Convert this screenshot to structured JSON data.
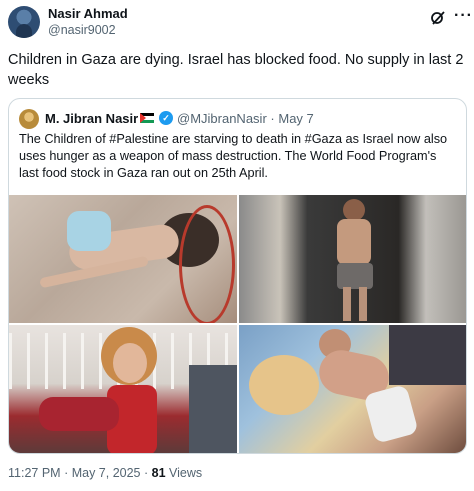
{
  "post": {
    "author_name": "Nasir Ahmad",
    "author_handle": "@nasir9002",
    "text": "Children in Gaza are dying. Israel has blocked food. No supply in last 2 weeks",
    "time": "11:27 PM",
    "separator": "·",
    "date": "May 7, 2025",
    "views_count": "81",
    "views_label": "Views"
  },
  "quote": {
    "author_name": "M. Jibran Nasir",
    "author_handle": "@MJibranNasir",
    "separator": "·",
    "date": "May 7",
    "text": "The Children of #Palestine are starving to death in #Gaza as Israel now also uses hunger as a weapon of mass destruction. The World Food Program's last food stock in Gaza ran out on 25th April."
  },
  "icons": {
    "header_actions": [
      "grok-icon",
      "more-options-icon"
    ],
    "verified": "verified-badge-icon",
    "flag": "palestine-flag-icon"
  },
  "colors": {
    "text": "#0f1419",
    "secondary": "#536471",
    "border": "#cfd9de",
    "verified": "#1d9bf0"
  }
}
